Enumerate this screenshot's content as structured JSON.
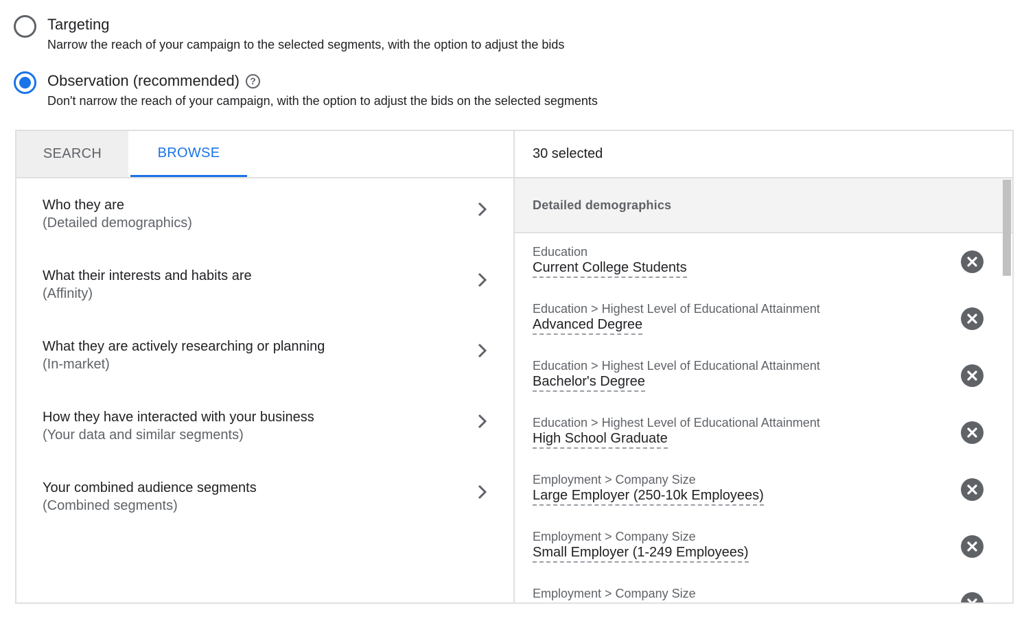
{
  "options": {
    "targeting": {
      "label": "Targeting",
      "description": "Narrow the reach of your campaign to the selected segments, with the option to adjust the bids",
      "checked": false
    },
    "observation": {
      "label": "Observation (recommended)",
      "description": "Don't narrow the reach of your campaign, with the option to adjust the bids on the selected segments",
      "checked": true,
      "help_icon": "help-circle-icon",
      "help_glyph": "?"
    }
  },
  "tabs": {
    "search": "SEARCH",
    "browse": "BROWSE",
    "active": "browse"
  },
  "categories": [
    {
      "title": "Who they are",
      "subtitle": "(Detailed demographics)"
    },
    {
      "title": "What their interests and habits are",
      "subtitle": "(Affinity)"
    },
    {
      "title": "What they are actively researching or planning",
      "subtitle": "(In-market)"
    },
    {
      "title": "How they have interacted with your business",
      "subtitle": "(Your data and similar segments)"
    },
    {
      "title": "Your combined audience segments",
      "subtitle": "(Combined segments)"
    }
  ],
  "selected": {
    "count_label": "30 selected",
    "group_header": "Detailed demographics",
    "items": [
      {
        "path": "Education",
        "value": "Current College Students"
      },
      {
        "path": "Education > Highest Level of Educational Attainment",
        "value": "Advanced Degree"
      },
      {
        "path": "Education > Highest Level of Educational Attainment",
        "value": "Bachelor's Degree"
      },
      {
        "path": "Education > Highest Level of Educational Attainment",
        "value": "High School Graduate"
      },
      {
        "path": "Employment > Company Size",
        "value": "Large Employer (250-10k Employees)"
      },
      {
        "path": "Employment > Company Size",
        "value": "Small Employer (1-249 Employees)"
      },
      {
        "path": "Employment > Company Size",
        "value": ""
      }
    ]
  },
  "colors": {
    "accent": "#1a73e8",
    "icon_gray": "#5f6368",
    "border": "#e0e0e0"
  }
}
